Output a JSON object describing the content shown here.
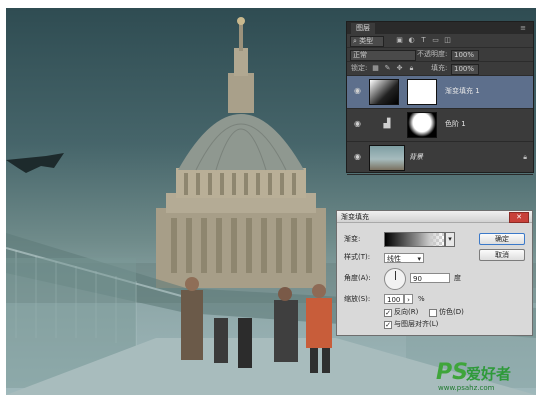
{
  "layers_panel": {
    "tab_label": "图层",
    "kind_filter": "类型",
    "blend_mode": "正常",
    "opacity_label": "不透明度:",
    "opacity_value": "100%",
    "lock_label": "锁定:",
    "fill_label": "填充:",
    "fill_value": "100%",
    "layers": [
      {
        "name": "渐变填充 1",
        "selected": true
      },
      {
        "name": "色阶 1",
        "selected": false
      },
      {
        "name": "背景",
        "selected": false
      }
    ]
  },
  "gradient_dialog": {
    "title": "渐变填充",
    "gradient_label": "渐变:",
    "style_label": "样式(T):",
    "style_value": "线性",
    "angle_label": "角度(A):",
    "angle_value": "90",
    "angle_unit": "度",
    "scale_label": "缩放(S):",
    "scale_value": "100",
    "scale_unit": "%",
    "reverse_label": "反向(R)",
    "dither_label": "仿色(D)",
    "align_label": "与图层对齐(L)",
    "reverse_checked": true,
    "dither_checked": false,
    "align_checked": true,
    "ok_label": "确定",
    "cancel_label": "取消"
  },
  "watermark": {
    "ps": "PS",
    "cn": "爱好者",
    "url": "www.psahz.com"
  }
}
